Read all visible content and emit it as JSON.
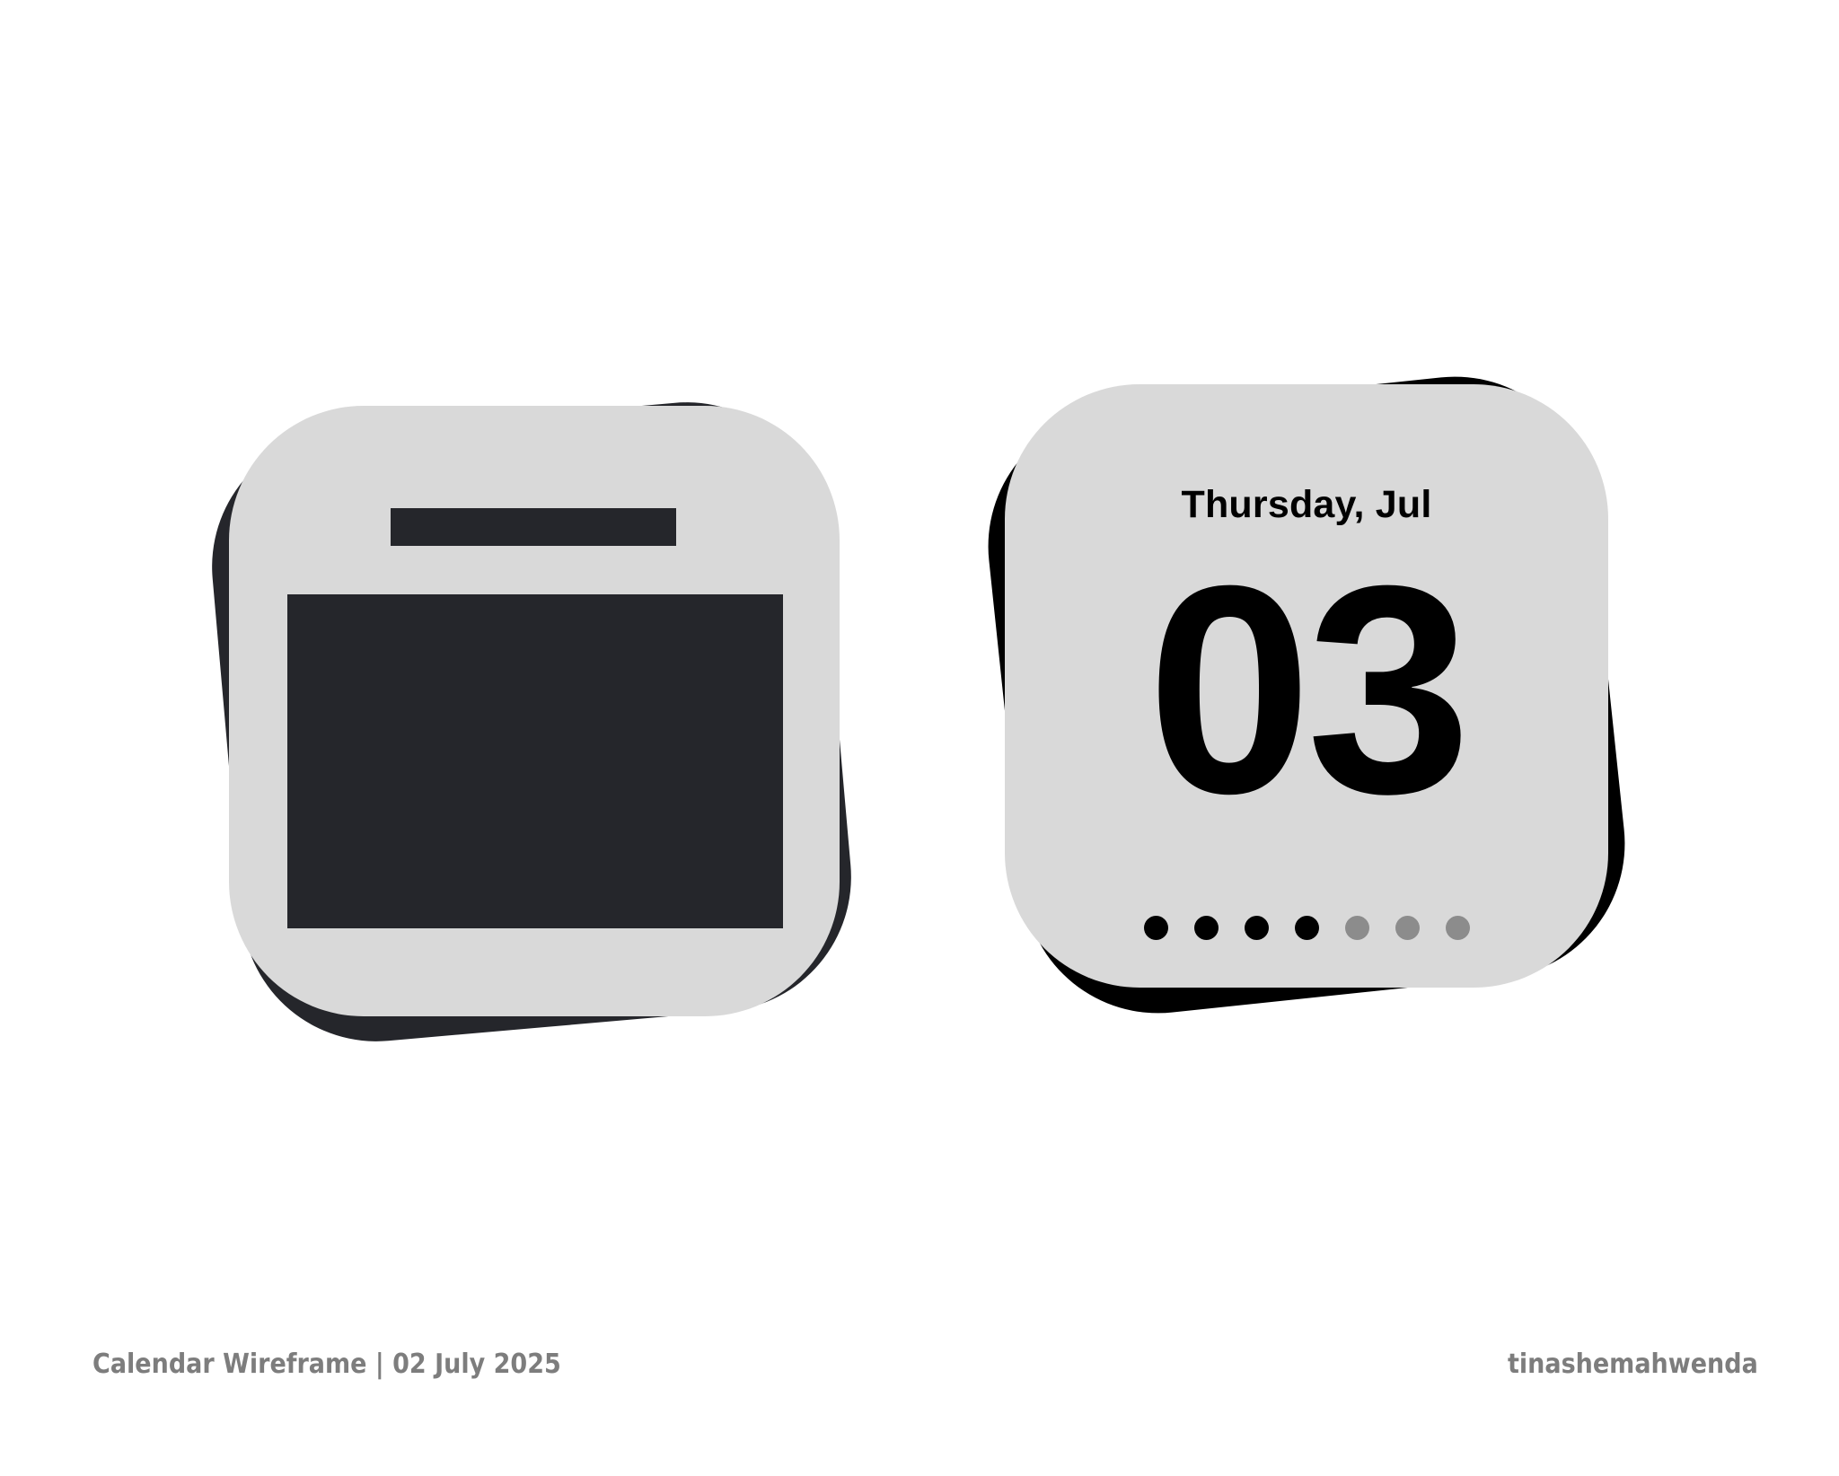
{
  "date_widget": {
    "weekday_month": "Thursday, Jul",
    "day": "03",
    "week_dots": {
      "total": 7,
      "active": 4
    }
  },
  "footer": {
    "caption": "Calendar Wireframe | 02 July 2025",
    "author": "tinashemahwenda"
  },
  "colors": {
    "card_face": "#d9d9d9",
    "wireframe_dark": "#25262b",
    "shadow_black": "#000000",
    "dot_active": "#000000",
    "dot_inactive": "#8c8c8c",
    "footer_text": "#7d7d7d"
  }
}
